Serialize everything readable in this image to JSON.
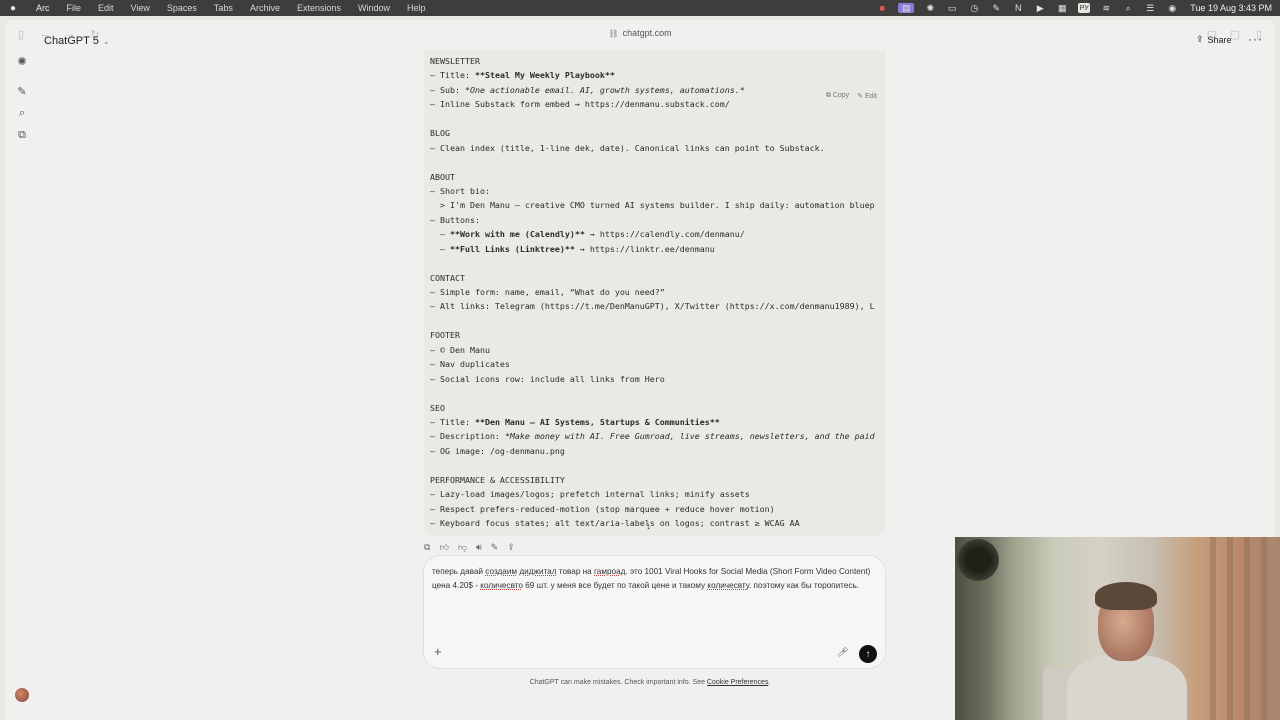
{
  "menubar": {
    "app": "Arc",
    "items": [
      "File",
      "Edit",
      "View",
      "Spaces",
      "Tabs",
      "Archive",
      "Extensions",
      "Window",
      "Help"
    ],
    "lang": "РУ",
    "clock": "Tue 19 Aug  3:43 PM"
  },
  "browser": {
    "url": "chatgpt.com"
  },
  "header": {
    "model": "ChatGPT 5",
    "share": "Share"
  },
  "code": {
    "copy": "Copy",
    "edit": "Edit",
    "lines": [
      [
        [
          "",
          "NEWSLETTER"
        ]
      ],
      [
        [
          "",
          "– Title: "
        ],
        [
          "b",
          "**Steal My Weekly Playbook**"
        ]
      ],
      [
        [
          "",
          "– Sub: "
        ],
        [
          "i",
          "*One actionable email. AI, growth systems, automations.*"
        ]
      ],
      [
        [
          "",
          "– Inline Substack form embed → https://denmanu.substack.com/"
        ]
      ],
      [
        [
          "",
          ""
        ]
      ],
      [
        [
          "",
          "BLOG"
        ]
      ],
      [
        [
          "",
          "– Clean index (title, 1-line dek, date). Canonical links can point to Substack."
        ]
      ],
      [
        [
          "",
          ""
        ]
      ],
      [
        [
          "",
          "ABOUT"
        ]
      ],
      [
        [
          "",
          "– Short bio:"
        ]
      ],
      [
        [
          "",
          "  > I'm Den Manu — creative CMO turned AI systems builder. I ship daily: automation bluep"
        ]
      ],
      [
        [
          "",
          "– Buttons:"
        ]
      ],
      [
        [
          "",
          "  – "
        ],
        [
          "b",
          "**Work with me (Calendly)**"
        ],
        [
          "",
          " → https://calendly.com/denmanu/"
        ]
      ],
      [
        [
          "",
          "  – "
        ],
        [
          "b",
          "**Full Links (Linktree)**"
        ],
        [
          "",
          " → https://linktr.ee/denmanu"
        ]
      ],
      [
        [
          "",
          ""
        ]
      ],
      [
        [
          "",
          "CONTACT"
        ]
      ],
      [
        [
          "",
          "– Simple form: name, email, “What do you need?”"
        ]
      ],
      [
        [
          "",
          "– Alt links: Telegram (https://t.me/DenManuGPT), X/Twitter (https://x.com/denmanu1989), L"
        ]
      ],
      [
        [
          "",
          ""
        ]
      ],
      [
        [
          "",
          "FOOTER"
        ]
      ],
      [
        [
          "",
          "– © Den Manu"
        ]
      ],
      [
        [
          "",
          "– Nav duplicates"
        ]
      ],
      [
        [
          "",
          "– Social icons row: include all links from Hero"
        ]
      ],
      [
        [
          "",
          ""
        ]
      ],
      [
        [
          "",
          "SEO"
        ]
      ],
      [
        [
          "",
          "– Title: "
        ],
        [
          "b",
          "**Den Manu — AI Systems, Startups & Communities**"
        ]
      ],
      [
        [
          "",
          "– Description: "
        ],
        [
          "i",
          "*Make money with AI. Free Gumroad, live streams, newsletters, and the paid"
        ]
      ],
      [
        [
          "",
          "– OG image: /og-denmanu.png"
        ]
      ],
      [
        [
          "",
          ""
        ]
      ],
      [
        [
          "",
          "PERFORMANCE & ACCESSIBILITY"
        ]
      ],
      [
        [
          "",
          "– Lazy-load images/logos; prefetch internal links; minify assets"
        ]
      ],
      [
        [
          "",
          "– Respect prefers-reduced-motion (stop marquee + reduce hover motion)"
        ]
      ],
      [
        [
          "",
          "– Keyboard focus states; alt text/aria-labels on logos; contrast ≥ WCAG AA"
        ]
      ]
    ]
  },
  "composer": {
    "segments": [
      [
        "",
        "теперь давай "
      ],
      [
        "u",
        "создаим"
      ],
      [
        "",
        " "
      ],
      [
        "u",
        "диджитал"
      ],
      [
        "",
        " товар на "
      ],
      [
        "u",
        "гамроад"
      ],
      [
        "",
        ". это 1001 Viral Hooks for Social Media (Short Form Video Content) цена 4.20$ - "
      ],
      [
        "u",
        "количесвто"
      ],
      [
        "",
        " 69 шт. у меня все будет по такой цене и такому "
      ],
      [
        "u",
        "количесвту"
      ],
      [
        "",
        ". поэтому как бы торопитесь."
      ]
    ]
  },
  "footer": {
    "disclaimer": "ChatGPT can make mistakes. Check important info. See ",
    "link": "Cookie Preferences",
    "end": "."
  },
  "icons": {
    "copy": "copy-icon",
    "thumbs_up": "thumbs-up-icon",
    "thumbs_down": "thumbs-down-icon",
    "read_aloud": "speaker-icon",
    "edit_in_canvas": "edit-icon",
    "share": "share-icon"
  }
}
